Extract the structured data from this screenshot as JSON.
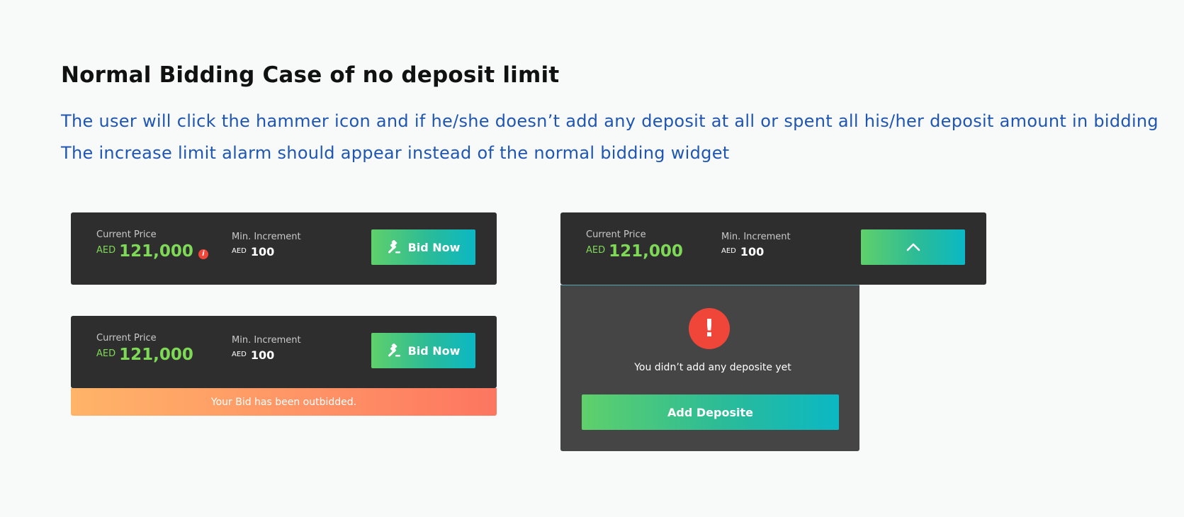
{
  "page": {
    "heading": "Normal Bidding Case of no deposit limit",
    "description_line1": "The user will click the hammer icon and if he/she doesn’t add any deposit at all or spent all his/her deposit amount in bidding",
    "description_line2": "The increase limit alarm should appear instead of the normal bidding widget"
  },
  "widget1": {
    "current_price_label": "Current Price",
    "currency": "AED",
    "current_price": "121,000",
    "info_icon_glyph": "i",
    "min_increment_label": "Min. Increment",
    "min_currency": "AED",
    "min_increment": "100",
    "bid_button_label": "Bid Now",
    "button_icon": "gavel-icon"
  },
  "widget2": {
    "current_price_label": "Current Price",
    "currency": "AED",
    "current_price": "121,000",
    "min_increment_label": "Min. Increment",
    "min_currency": "AED",
    "min_increment": "100",
    "bid_button_label": "Bid Now",
    "button_icon": "gavel-icon",
    "outbid_message": "Your Bid has been outbidded."
  },
  "widget3": {
    "current_price_label": "Current Price",
    "currency": "AED",
    "current_price": "121,000",
    "min_increment_label": "Min. Increment",
    "min_currency": "AED",
    "min_increment": "100",
    "toggle_icon": "chevron-up-icon",
    "alert_glyph": "!",
    "alert_message": "You didn’t add any deposite yet",
    "add_deposit_label": "Add Deposite"
  },
  "colors": {
    "price_green": "#7ed957",
    "bar_bg": "#2e2e2e",
    "alert_red": "#f0463a",
    "description_blue": "#1f56b3"
  }
}
